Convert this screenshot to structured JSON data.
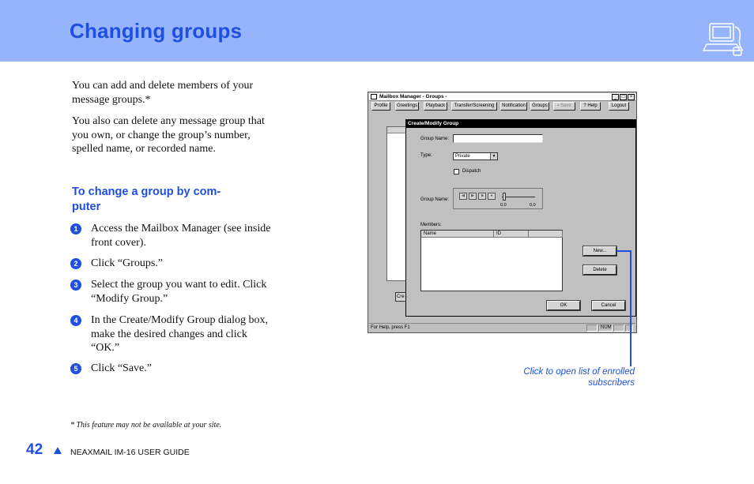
{
  "header": {
    "title": "Changing groups",
    "icon": "computer-phone-icon"
  },
  "intro": [
    "You can add and delete members of your message groups.*",
    "You also can delete any message group that you own, or change the group’s number, spelled name, or recorded name."
  ],
  "subheading": "To change a group by com-\nputer",
  "steps": [
    {
      "n": "1",
      "text": "Access the Mailbox Manager (see inside front cover)."
    },
    {
      "n": "2",
      "text": "Click “Groups.”"
    },
    {
      "n": "3",
      "text": "Select the group you want to edit. Click “Modify Group.”"
    },
    {
      "n": "4",
      "text": "In the Create/Modify Group dialog box, make the desired changes and click “OK.”"
    },
    {
      "n": "5",
      "text": "Click “Save.”"
    }
  ],
  "footnote": "* This feature may not be available at your site.",
  "footer": {
    "page": "42",
    "guide": "NEAXMAIL IM-16 USER GUIDE"
  },
  "screenshot": {
    "window_title": "Mailbox Manager - Groups -",
    "toolbar": [
      "Profile",
      "Greetings",
      "Playback",
      "Transfer/Screening",
      "Notification",
      "Groups",
      "Save",
      "Help",
      "Logout"
    ],
    "status_text": "For Help, press F1",
    "status_num": "NUM",
    "left_button": "Cre",
    "dialog": {
      "title": "Create/Modify Group",
      "group_name_label": "Group Name:",
      "type_label": "Type:",
      "type_value": "Private",
      "dispatch_label": "Dispatch",
      "recorded_label": "Group Name:",
      "time_a": "0.0",
      "time_b": "0.0",
      "members_label": "Members:",
      "col_name": "Name",
      "col_id": "ID",
      "new_button": "New...",
      "delete_button": "Delete",
      "ok_button": "OK",
      "cancel_button": "Cancel"
    }
  },
  "callout": "Click to open list of enrolled subscribers"
}
